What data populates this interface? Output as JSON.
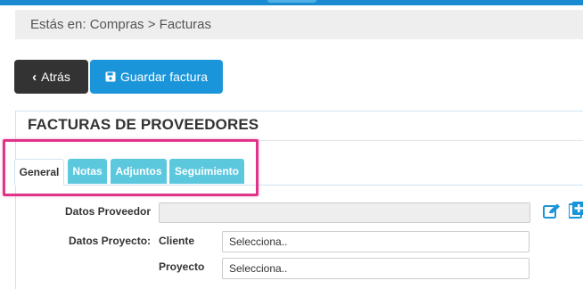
{
  "breadcrumb": {
    "prefix": "Estás en: ",
    "section": "Compras",
    "separator": " > ",
    "page": "Facturas"
  },
  "toolbar": {
    "back_label": "Atrás",
    "save_label": "Guardar factura"
  },
  "panel": {
    "title": "FACTURAS DE PROVEEDORES"
  },
  "tabs": [
    {
      "label": "General",
      "active": true
    },
    {
      "label": "Notas"
    },
    {
      "label": "Adjuntos"
    },
    {
      "label": "Seguimiento"
    }
  ],
  "form": {
    "supplier_label": "Datos Proveedor",
    "supplier_value": "",
    "project_label": "Datos Proyecto:",
    "client_label": "Cliente",
    "client_value": "Selecciona..",
    "project_sub_label": "Proyecto",
    "project_value": "Selecciona.."
  },
  "icons": {
    "edit": "edit-icon",
    "add": "add-icon"
  },
  "colors": {
    "accent": "#1b95da",
    "tab": "#5bc8de",
    "highlight": "#e0338a",
    "dark_button": "#333333"
  }
}
